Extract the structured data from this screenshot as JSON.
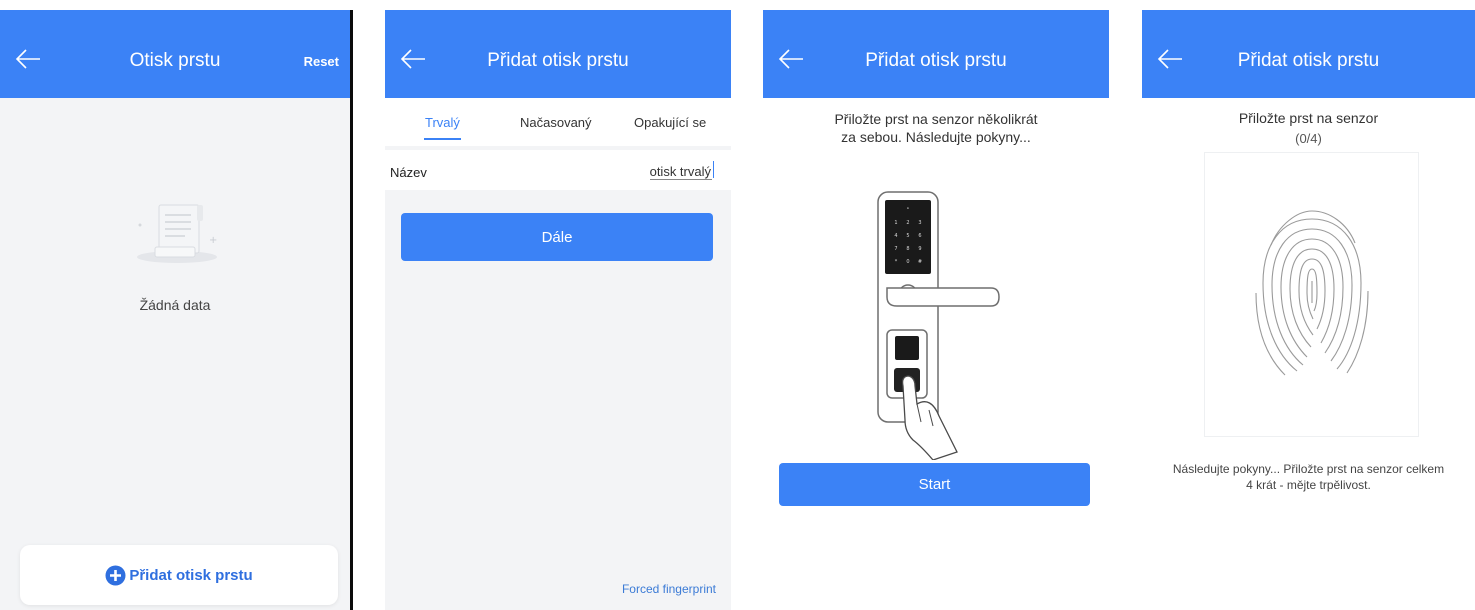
{
  "colors": {
    "accent": "#3b82f6",
    "link": "#3b7bd6"
  },
  "screen1": {
    "title": "Otisk prstu",
    "reset_label": "Reset",
    "empty_text": "Žádná data",
    "add_label": "Přidat otisk prstu",
    "icons": [
      "back-arrow-icon",
      "empty-document-icon",
      "plus-circle-icon"
    ]
  },
  "screen2": {
    "title": "Přidat otisk prstu",
    "tabs": [
      {
        "label": "Trvalý",
        "active": true
      },
      {
        "label": "Načasovaný",
        "active": false
      },
      {
        "label": "Opakující se",
        "active": false
      }
    ],
    "name_label": "Název",
    "name_value": "otisk trvalý",
    "next_label": "Dále",
    "forced_label": "Forced fingerprint"
  },
  "screen3": {
    "title": "Přidat otisk prstu",
    "instruction_line1": "Přiložte prst na senzor několikrát",
    "instruction_line2": "za sebou. Následujte pokyny...",
    "keypad_keys": [
      "1",
      "2",
      "3",
      "4",
      "5",
      "6",
      "7",
      "8",
      "9",
      "*",
      "0",
      "#"
    ],
    "start_label": "Start"
  },
  "screen4": {
    "title": "Přidat otisk prstu",
    "prompt": "Přiložte prst na senzor",
    "progress_text": "(0/4)",
    "progress": {
      "done": 0,
      "total": 4
    },
    "help_line1": "Následujte pokyny... Přiložte prst na senzor celkem",
    "help_line2": "4 krát - mějte trpělivost."
  }
}
